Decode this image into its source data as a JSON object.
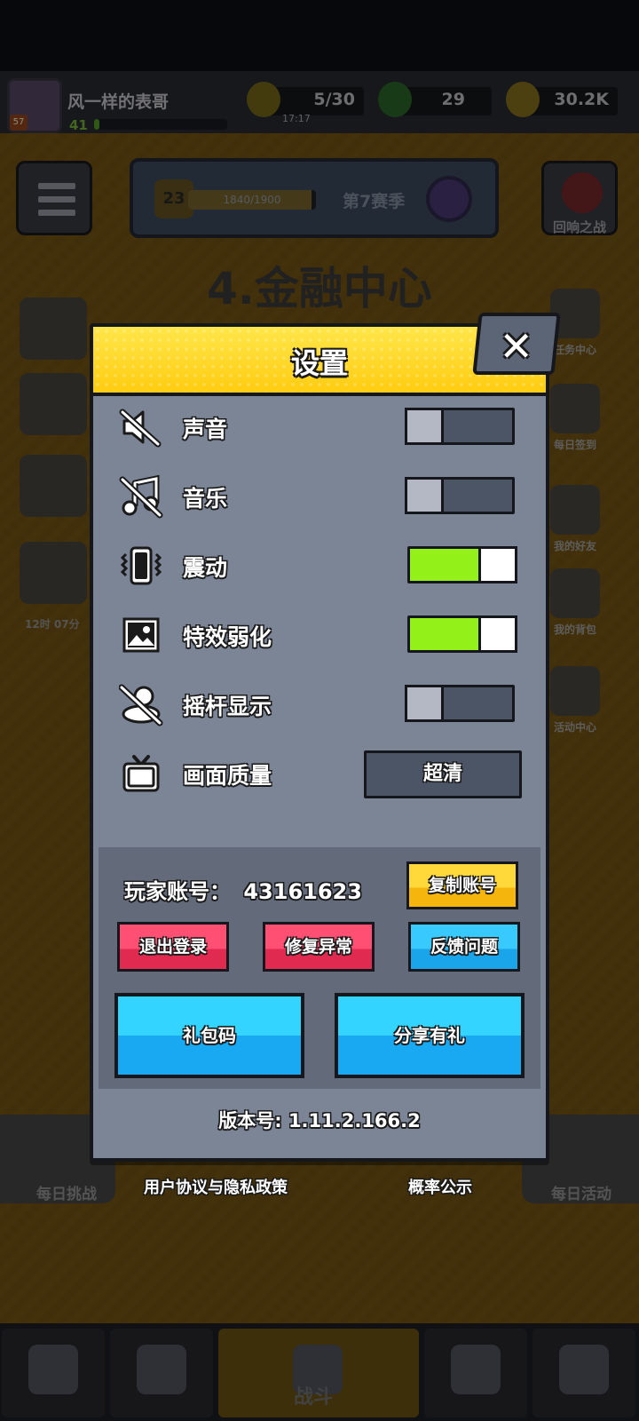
{
  "status_bar": {
    "player_name": "风一样的表哥",
    "player_level": "41",
    "avatar_level": "57",
    "energy": "5/30",
    "energy_timer": "17:17",
    "gems": "29",
    "coins": "30.2K"
  },
  "season": {
    "level": "23",
    "progress_text": "1840/1900",
    "progress": 0.968,
    "name": "第7赛季"
  },
  "echo_battle_label": "回响之战",
  "map_title": "4.金融中心",
  "side_menu": [
    {
      "label": "任务中心"
    },
    {
      "label": "每日签到"
    },
    {
      "label": "我的好友"
    },
    {
      "label": "我的背包"
    },
    {
      "label": "活动中心"
    }
  ],
  "left_timer": "12时 07分",
  "bottom_buttons": {
    "left_label": "每日挑战",
    "right_label": "每日活动"
  },
  "nav": {
    "fight_label": "战斗"
  },
  "settings": {
    "title": "设置",
    "close_icon": "close-icon",
    "rows": [
      {
        "label": "声音",
        "icon": "sound-muted-icon",
        "enabled": false
      },
      {
        "label": "音乐",
        "icon": "music-muted-icon",
        "enabled": false
      },
      {
        "label": "震动",
        "icon": "vibration-icon",
        "enabled": true
      },
      {
        "label": "特效弱化",
        "icon": "image-icon",
        "enabled": true
      },
      {
        "label": "摇杆显示",
        "icon": "joystick-hidden-icon",
        "enabled": false
      }
    ],
    "quality": {
      "label": "画面质量",
      "icon": "tv-icon",
      "value": "超清"
    },
    "account": {
      "label": "玩家账号：",
      "id": "43161623",
      "copy_label": "复制账号",
      "logout_label": "退出登录",
      "repair_label": "修复异常",
      "feedback_label": "反馈问题",
      "gift_code_label": "礼包码",
      "share_label": "分享有礼"
    },
    "version": "版本号: 1.11.2.166.2"
  },
  "footer_links": {
    "agreement": "用户协议与隐私政策",
    "probability": "概率公示"
  },
  "colors": {
    "header_yellow": "#ffd51e",
    "panel_gray": "#7c8596",
    "toggle_on": "#93f019",
    "toggle_off": "#4c5566",
    "button_red": "#e02a50",
    "button_blue": "#1aa5ea",
    "button_yellow": "#f5b50c"
  }
}
